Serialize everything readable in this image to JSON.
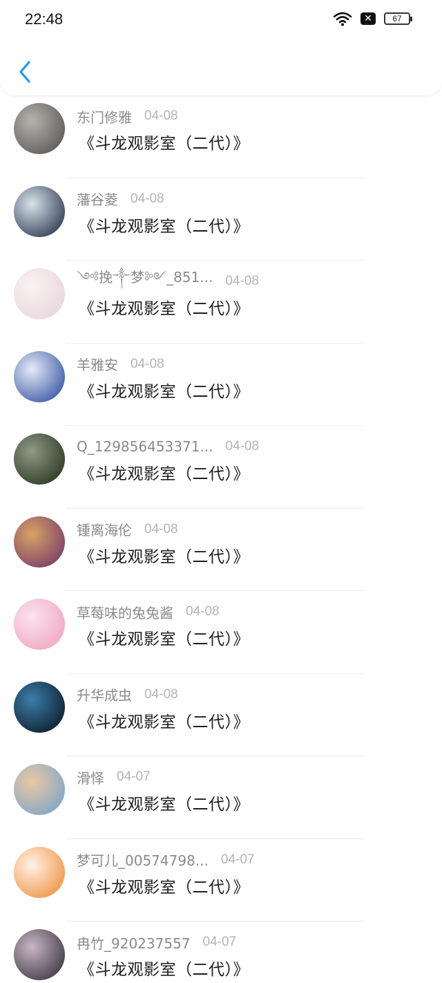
{
  "status_bar": {
    "time": "22:48",
    "battery": "67",
    "icons": [
      "wifi-icon",
      "x-box-icon",
      "battery-icon"
    ]
  },
  "header": {
    "back_icon": "chevron-left-icon",
    "accent_color": "#1e9be6"
  },
  "items": [
    {
      "name": "东门修雅",
      "date": "04-08",
      "title": "《斗龙观影室（二代）》",
      "avatar_colors": [
        "#5d5a58",
        "#b6b2ad"
      ]
    },
    {
      "name": "藩谷菱",
      "date": "04-08",
      "title": "《斗龙观影室（二代）》",
      "avatar_colors": [
        "#2f3d52",
        "#d8e2ea"
      ]
    },
    {
      "name": "༺挽༒梦༻_851...",
      "date": "04-08",
      "title": "《斗龙观影室（二代）》",
      "avatar_colors": [
        "#e9d6dc",
        "#faf1f3"
      ]
    },
    {
      "name": "羊雅安",
      "date": "04-08",
      "title": "《斗龙观影室（二代）》",
      "avatar_colors": [
        "#3d58a6",
        "#e4ecf6"
      ]
    },
    {
      "name": "Q_129856453371...",
      "date": "04-08",
      "title": "《斗龙观影室（二代）》",
      "avatar_colors": [
        "#2b3a24",
        "#8d9a86"
      ]
    },
    {
      "name": "锺离海伦",
      "date": "04-08",
      "title": "《斗龙观影室（二代）》",
      "avatar_colors": [
        "#7a3f6a",
        "#d8a264"
      ]
    },
    {
      "name": "草莓味的兔兔酱",
      "date": "04-08",
      "title": "《斗龙观影室（二代）》",
      "avatar_colors": [
        "#f0a6c1",
        "#fbe3ee"
      ]
    },
    {
      "name": "升华成虫",
      "date": "04-08",
      "title": "《斗龙观影室（二代）》",
      "avatar_colors": [
        "#0f1d2e",
        "#3a7fa8"
      ]
    },
    {
      "name": "滑怿",
      "date": "04-07",
      "title": "《斗龙观影室（二代）》",
      "avatar_colors": [
        "#7fa6c8",
        "#e8c9a4"
      ]
    },
    {
      "name": "梦可儿_00574798...",
      "date": "04-07",
      "title": "《斗龙观影室（二代）》",
      "avatar_colors": [
        "#f09445",
        "#fff2e6"
      ]
    },
    {
      "name": "冉竹_920237557",
      "date": "04-07",
      "title": "《斗龙观影室（二代）》",
      "avatar_colors": [
        "#3f3a44",
        "#c8b6c4"
      ]
    }
  ]
}
